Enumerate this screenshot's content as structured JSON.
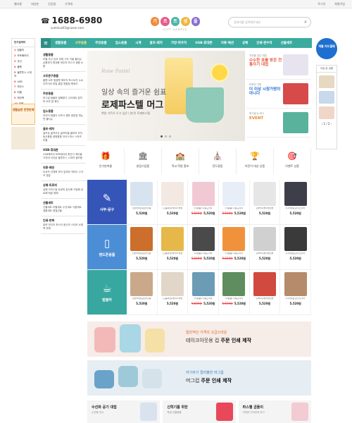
{
  "topbar": {
    "left": [
      "웹사용",
      "대상분",
      "인공법",
      "가격대"
    ],
    "right": [
      "로그인",
      "회원가입"
    ]
  },
  "header": {
    "phone": "1688-6980",
    "email": "summuil45@naver.com",
    "logo_letters": [
      "기",
      "프",
      "트",
      "샘",
      "플"
    ],
    "logo_sub": "GIFT SAMPLE",
    "search_placeholder": "검색어를 입력해주세요"
  },
  "nav": {
    "items": [
      "생활용품",
      "사무용품",
      "주방용품",
      "업소용품",
      "시계",
      "골프·레저",
      "가방·파우치",
      "USB·휴대폰",
      "의류·패션",
      "상패",
      "인쇄·판수작",
      "선물세트"
    ],
    "active": 1
  },
  "left_sidebar": {
    "title": "인기검색어",
    "items": [
      {
        "rank": "1",
        "label": "텀블러"
      },
      {
        "rank": "2",
        "label": "보조배터리"
      },
      {
        "rank": "3",
        "label": "우산"
      },
      {
        "rank": "4",
        "label": "볼펜"
      },
      {
        "rank": "5",
        "label": "블루투스 스피커"
      },
      {
        "rank": "6",
        "label": "USB"
      },
      {
        "rank": "7",
        "label": "마우스"
      },
      {
        "rank": "8",
        "label": "타월"
      },
      {
        "rank": "9",
        "label": "에코백"
      },
      {
        "rank": "10",
        "label": "달력"
      }
    ],
    "ad_text": "생활습관 한정판매"
  },
  "categories": [
    {
      "title": "생활용품",
      "text": "타월 우산 담요 부채 스틱 거울 물티슈 손톱깎이 휴대용 파우치 마스크 생활 소품"
    },
    {
      "title": "사무문구용품",
      "text": "볼펜 샤프 형광펜 메모지 포스트잇 노트 다이어리 파일 클립 명함첩 펜꽂이"
    },
    {
      "title": "주방용품",
      "text": "머그컵 텀블러 밀폐용기 수저세트 앞치마 도마 칼 행주"
    },
    {
      "title": "업소용품",
      "text": "라이터 재떨이 오프너 쟁반 컵받침 메뉴판 물티슈"
    },
    {
      "title": "골프·레저",
      "text": "골프공 골프우산 골프타월 볼마커 모자 등산용품 캠핑용품 아이스박스 스포츠타월"
    },
    {
      "title": "USB·휴대폰",
      "text": "USB메모리 보조배터리 충전기 케이블 거치대 이어폰 블루투스 스피커 셀카봉"
    },
    {
      "title": "의류·패션",
      "text": "티셔츠 단체복 모자 앞치마 넥타이 스카프 양말"
    },
    {
      "title": "상패·트로피",
      "text": "상패 크리스탈 트로피 감사패 기념패 공로패 메달 명패"
    },
    {
      "title": "선물세트",
      "text": "선물세트 타월세트 수건세트 식품세트 생활세트 명절선물"
    },
    {
      "title": "인쇄·판촉",
      "text": "달력 전단지 포스터 현수막 스티커 쇼핑백 부채"
    }
  ],
  "banner": {
    "en": "Rose Pastel",
    "line1": "일상 속의 즐거운 쉼표",
    "line2": "로제파스텔 머그",
    "line3": "햇살 가득히 우고 싶은 나만의 로제파스텔"
  },
  "promos": [
    {
      "t1": "자연을 담은 대접",
      "t2": "수수한 표를 받은 전통자기 대접",
      "color": "#e55a3c",
      "pic": "#e7e3ef"
    },
    {
      "t1": "타포린 가방",
      "t2": "더 이상 시장가방이 아니다",
      "color": "#2a6ed5",
      "pic": "#d64a4a"
    },
    {
      "t1": "머그컵 & 머그",
      "t2": "EVENT",
      "color": "#e58b2a",
      "pic": "#58b29c"
    }
  ],
  "quick": {
    "label": "개별 카드결제"
  },
  "right_sidebar": {
    "title": "오늘 본 상품",
    "page": "1 / 2"
  },
  "icon_row": [
    {
      "icon": "🎁",
      "label": "인기판촉물"
    },
    {
      "icon": "🏛",
      "label": "창립기념품"
    },
    {
      "icon": "🏫",
      "label": "학교·학원 홍보"
    },
    {
      "icon": "⛪",
      "label": "전도용품"
    },
    {
      "icon": "🏆",
      "label": "어린이 대상 상품"
    },
    {
      "icon": "🎯",
      "label": "이벤트 상품"
    }
  ],
  "product_rows": [
    {
      "label": "사무·문구",
      "icon": "✎",
      "color": "#3556b8",
      "items": [
        {
          "name": "[판]아레르닷판2인용",
          "price": "5,520원",
          "sale": "",
          "img": "#d7e4ef"
        },
        {
          "name": "[고품씨한]레이피 볼펜",
          "price": "5,520원",
          "sale": "",
          "img": "#f3e9e2"
        },
        {
          "name": "[더원품] 다용도리리",
          "price": "5,520원",
          "sale": "5,520원",
          "img": "#f0c9d4"
        },
        {
          "name": "[더원품] 다용도리리",
          "price": "5,520원",
          "sale": "5,520원",
          "img": "#e8eef7"
        },
        {
          "name": "홍부이주방리엔선물",
          "price": "5,520원",
          "sale": "",
          "img": "#e6e6e6"
        },
        {
          "name": "[다이렐로모]나소할이",
          "price": "5,520원",
          "sale": "",
          "img": "#3e3e4a"
        }
      ]
    },
    {
      "label": "핸드폰용품",
      "icon": "▯",
      "color": "#4b8ed6",
      "items": [
        {
          "name": "[판]아레르닷판2인용",
          "price": "5,520원",
          "sale": "",
          "img": "#cc6e2c"
        },
        {
          "name": "[고품씨한]레이피 볼펜",
          "price": "5,520원",
          "sale": "",
          "img": "#e6b84a"
        },
        {
          "name": "[더원품] 다용도리리",
          "price": "5,520원",
          "sale": "5,520원",
          "img": "#4a4a4a"
        },
        {
          "name": "[더원품] 다용도리리",
          "price": "5,520원",
          "sale": "5,520원",
          "img": "#f0923c"
        },
        {
          "name": "홍부이주방리엔선물",
          "price": "5,520원",
          "sale": "",
          "img": "#d0d0d0"
        },
        {
          "name": "[다이렐로모]나소할이",
          "price": "5,520원",
          "sale": "",
          "img": "#3a3a3a"
        }
      ]
    },
    {
      "label": "텀블러",
      "icon": "☕",
      "color": "#37a7a0",
      "items": [
        {
          "name": "[판]아레르닷판2인용",
          "price": "5,520원",
          "sale": "",
          "img": "#c9a989"
        },
        {
          "name": "[고품씨한]레이피 볼펜",
          "price": "5,520원",
          "sale": "",
          "img": "#e1d6c8"
        },
        {
          "name": "[더원품] 다용도리리",
          "price": "5,520원",
          "sale": "5,520원",
          "img": "#6c9cb5"
        },
        {
          "name": "[더원품] 다용도리리",
          "price": "5,520원",
          "sale": "5,520원",
          "img": "#5f8d5f"
        },
        {
          "name": "홍부이주방리엔선물",
          "price": "5,520원",
          "sale": "",
          "img": "#d04a3e"
        },
        {
          "name": "[다이렐로모]나소할이",
          "price": "5,520원",
          "sale": "",
          "img": "#b58b6b"
        }
      ]
    }
  ],
  "banner2": {
    "sub": "합리적인 가격의 고급스러운",
    "main_pre": "테이크아웃용 컵 ",
    "main_bold": "주문 인쇄 제작"
  },
  "banner3": {
    "sub": "어기자기 컬러풀한 머그컵",
    "main_pre": "머그컵 ",
    "main_bold": "주문 인쇄 제작"
  },
  "tiles": [
    {
      "title": "수선화 공기 대접",
      "sub": "수선화 무늬",
      "pic": "#d9e3f0"
    },
    {
      "title": "신학기를 위한",
      "sub": "학생 선물용품",
      "pic": "#e8485a"
    },
    {
      "title": "파스텔 곰돌이",
      "sub": "귀여운 디자인의 머그",
      "pic": "#f2cbd3"
    }
  ]
}
